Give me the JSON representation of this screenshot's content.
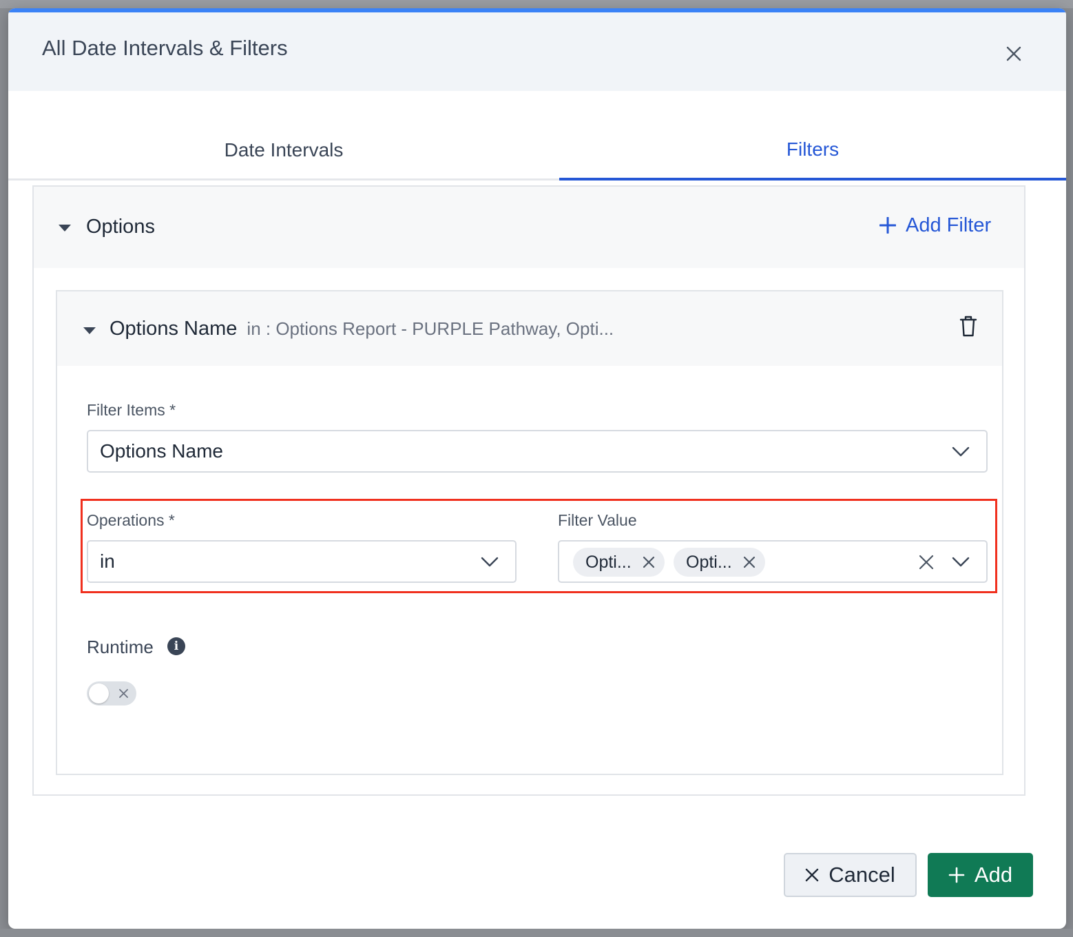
{
  "modal": {
    "title": "All Date Intervals & Filters"
  },
  "tabs": [
    {
      "label": "Date Intervals",
      "active": false
    },
    {
      "label": "Filters",
      "active": true
    }
  ],
  "filter_group": {
    "title": "Options",
    "add_filter_label": "Add Filter"
  },
  "filter_card": {
    "title": "Options Name",
    "summary": "in : Options Report - PURPLE Pathway, Opti...",
    "filter_items": {
      "label": "Filter Items *",
      "value": "Options Name"
    },
    "operations": {
      "label": "Operations *",
      "value": "in"
    },
    "filter_value": {
      "label": "Filter Value",
      "tags": [
        "Opti...",
        "Opti..."
      ]
    },
    "runtime": {
      "label": "Runtime",
      "enabled": false
    }
  },
  "footer": {
    "cancel_label": "Cancel",
    "add_label": "Add"
  },
  "colors": {
    "primary_blue": "#2557d6",
    "add_green": "#107a55",
    "highlight_red": "#f0301e"
  }
}
